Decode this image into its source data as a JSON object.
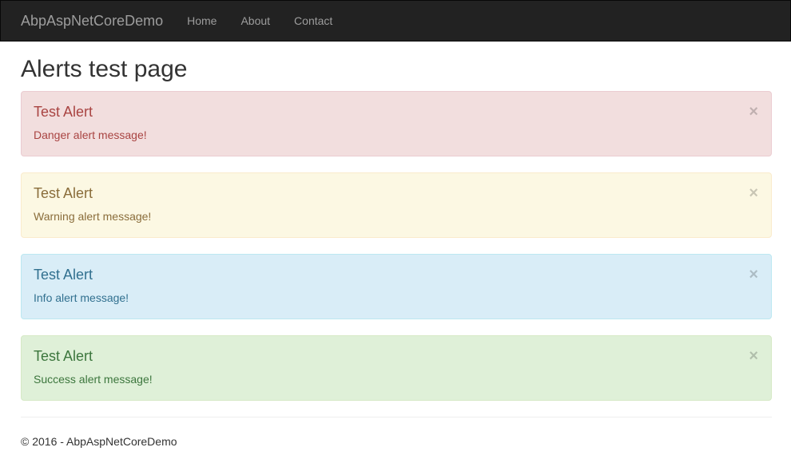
{
  "navbar": {
    "brand": "AbpAspNetCoreDemo",
    "links": [
      "Home",
      "About",
      "Contact"
    ]
  },
  "page": {
    "title": "Alerts test page"
  },
  "alerts": [
    {
      "type": "danger",
      "title": "Test Alert",
      "message": "Danger alert message!",
      "close": "×"
    },
    {
      "type": "warning",
      "title": "Test Alert",
      "message": "Warning alert message!",
      "close": "×"
    },
    {
      "type": "info",
      "title": "Test Alert",
      "message": "Info alert message!",
      "close": "×"
    },
    {
      "type": "success",
      "title": "Test Alert",
      "message": "Success alert message!",
      "close": "×"
    }
  ],
  "footer": {
    "text": "© 2016 - AbpAspNetCoreDemo"
  },
  "colors": {
    "navbar_bg": "#222222",
    "danger_bg": "#f2dede",
    "warning_bg": "#fcf8e3",
    "info_bg": "#d9edf7",
    "success_bg": "#dff0d8"
  }
}
